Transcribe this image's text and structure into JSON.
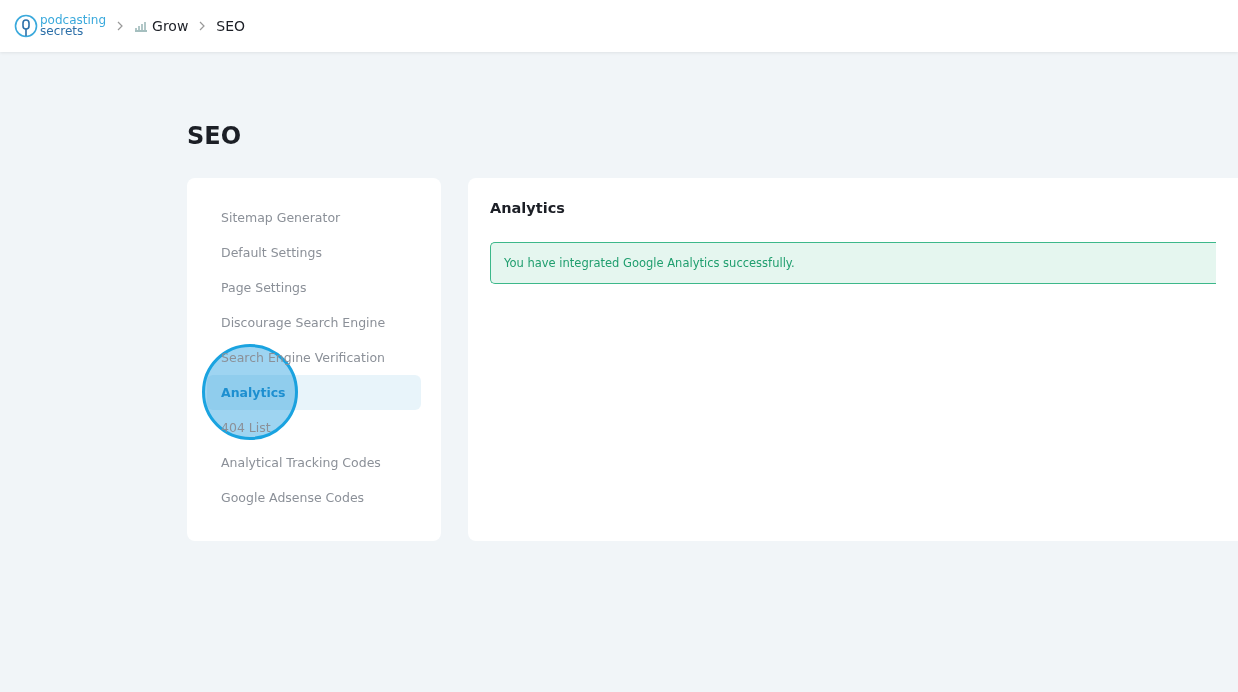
{
  "header": {
    "logo": {
      "line_1": "podcasting",
      "line_2": "secrets"
    },
    "breadcrumbs": [
      {
        "label": "Grow",
        "kind": "section"
      },
      {
        "label": "SEO",
        "kind": "page"
      }
    ]
  },
  "page_title": "SEO",
  "sidebar": {
    "items": [
      {
        "label": "Sitemap Generator",
        "selected": false,
        "clicked": false
      },
      {
        "label": "Default Settings",
        "selected": false,
        "clicked": false
      },
      {
        "label": "Page Settings",
        "selected": false,
        "clicked": false
      },
      {
        "label": "Discourage Search Engine",
        "selected": false,
        "clicked": false
      },
      {
        "label": "Search Engine Verification",
        "selected": false,
        "clicked": false
      },
      {
        "label": "Analytics",
        "selected": true,
        "clicked": true
      },
      {
        "label": "404 List",
        "selected": false,
        "clicked": false
      },
      {
        "label": "Analytical Tracking Codes",
        "selected": false,
        "clicked": false
      },
      {
        "label": "Google Adsense Codes",
        "selected": false,
        "clicked": false
      }
    ]
  },
  "panel": {
    "title": "Analytics",
    "alert": {
      "kind": "success",
      "message": "You have integrated Google Analytics successfully."
    }
  }
}
